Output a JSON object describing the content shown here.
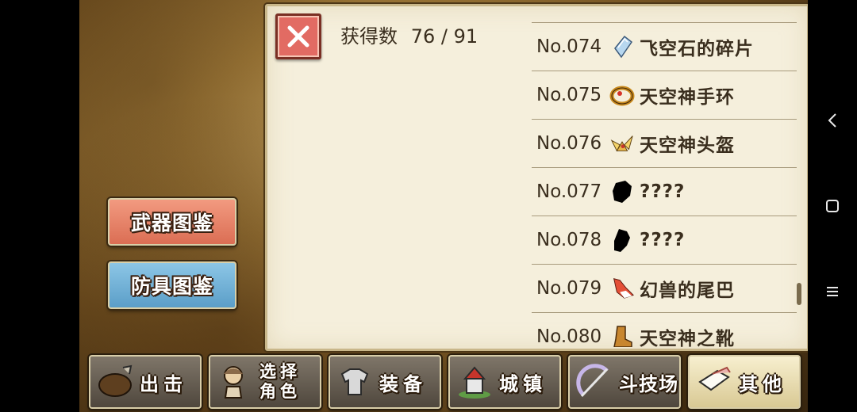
{
  "catalog_buttons": {
    "weapon": "武器图鉴",
    "armor": "防具图鉴"
  },
  "panel": {
    "count_label": "获得数",
    "count_value": "76 / 91",
    "items": [
      {
        "num": "No.074",
        "name": "飞空石的碎片",
        "icon": "crystal-shard-icon"
      },
      {
        "num": "No.075",
        "name": "天空神手环",
        "icon": "bracelet-icon"
      },
      {
        "num": "No.076",
        "name": "天空神头盔",
        "icon": "winged-helmet-icon"
      },
      {
        "num": "No.077",
        "name": "????",
        "icon": "unknown-silhouette-icon"
      },
      {
        "num": "No.078",
        "name": "????",
        "icon": "unknown-silhouette-icon"
      },
      {
        "num": "No.079",
        "name": "幻兽的尾巴",
        "icon": "beast-tail-icon"
      },
      {
        "num": "No.080",
        "name": "天空神之靴",
        "icon": "boots-icon"
      }
    ]
  },
  "tabs": [
    {
      "line1": "出击",
      "line2": "",
      "icon": "sortie-shield-icon"
    },
    {
      "line1": "选择",
      "line2": "角色",
      "icon": "character-icon"
    },
    {
      "line1": "装备",
      "line2": "",
      "icon": "armor-icon"
    },
    {
      "line1": "城镇",
      "line2": "",
      "icon": "castle-icon"
    },
    {
      "line1": "斗技场",
      "line2": "",
      "icon": "arena-icon"
    },
    {
      "line1": "其他",
      "line2": "",
      "icon": "scroll-icon"
    }
  ],
  "active_tab": "其他",
  "colors": {
    "weapon_button": "#db6e54",
    "armor_button": "#5b9ec8",
    "close_button": "#e26b63"
  }
}
